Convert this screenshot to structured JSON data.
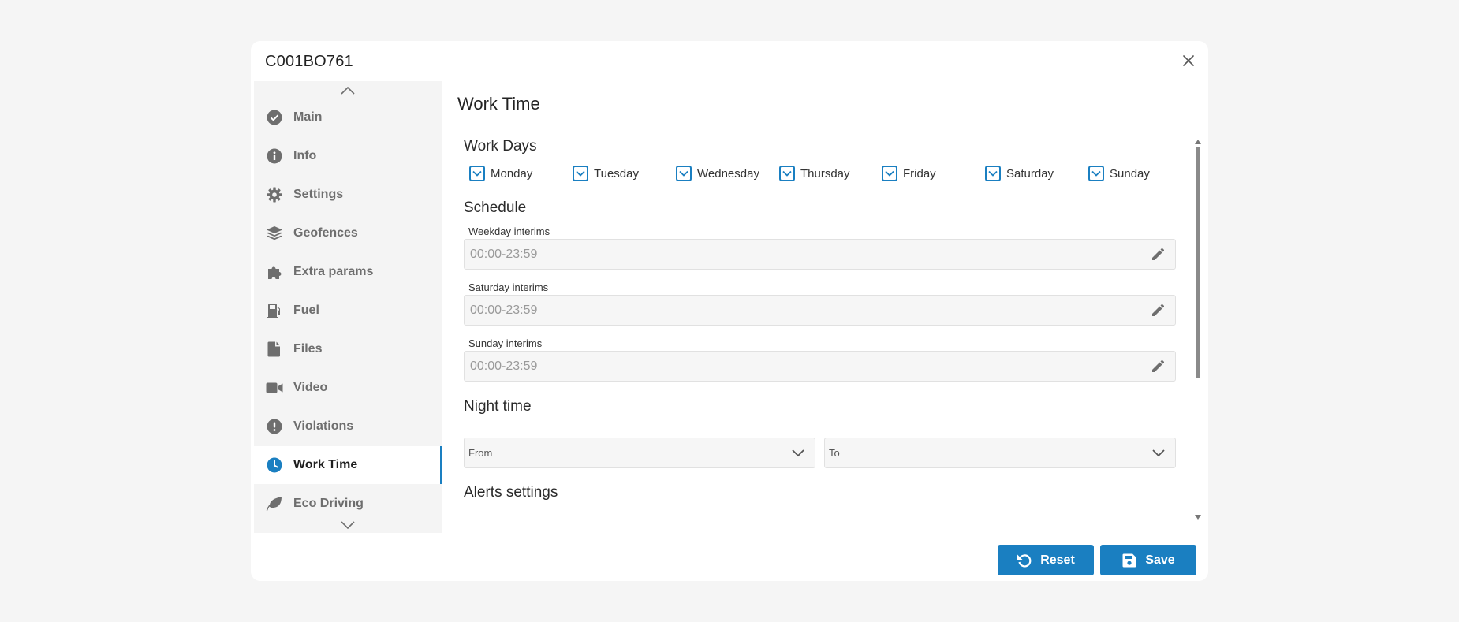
{
  "dialog": {
    "title": "C001BO761"
  },
  "sidebar": {
    "items": [
      {
        "label": "Main",
        "icon": "check-circle-icon"
      },
      {
        "label": "Info",
        "icon": "info-icon"
      },
      {
        "label": "Settings",
        "icon": "gear-icon"
      },
      {
        "label": "Geofences",
        "icon": "layers-icon"
      },
      {
        "label": "Extra params",
        "icon": "puzzle-icon"
      },
      {
        "label": "Fuel",
        "icon": "fuel-pump-icon"
      },
      {
        "label": "Files",
        "icon": "file-icon"
      },
      {
        "label": "Video",
        "icon": "video-camera-icon"
      },
      {
        "label": "Violations",
        "icon": "exclamation-circle-icon"
      },
      {
        "label": "Work Time",
        "icon": "clock-icon",
        "active": true
      },
      {
        "label": "Eco Driving",
        "icon": "leaf-icon"
      }
    ]
  },
  "content": {
    "title": "Work Time",
    "work_days": {
      "title": "Work Days",
      "days": [
        {
          "label": "Monday",
          "checked": true
        },
        {
          "label": "Tuesday",
          "checked": true
        },
        {
          "label": "Wednesday",
          "checked": true
        },
        {
          "label": "Thursday",
          "checked": true
        },
        {
          "label": "Friday",
          "checked": true
        },
        {
          "label": "Saturday",
          "checked": true
        },
        {
          "label": "Sunday",
          "checked": true
        }
      ]
    },
    "schedule": {
      "title": "Schedule",
      "fields": [
        {
          "label": "Weekday interims",
          "value": "00:00-23:59"
        },
        {
          "label": "Saturday interims",
          "value": "00:00-23:59"
        },
        {
          "label": "Sunday interims",
          "value": "00:00-23:59"
        }
      ]
    },
    "night_time": {
      "title": "Night time",
      "from_placeholder": "From",
      "to_placeholder": "To"
    },
    "alerts": {
      "title": "Alerts settings"
    }
  },
  "footer": {
    "reset_label": "Reset",
    "save_label": "Save"
  },
  "colors": {
    "accent": "#1a7fc1",
    "background": "#f5f5f5",
    "sidebar_bg": "#f4f4f4",
    "icon_gray": "#6e6e6e"
  }
}
